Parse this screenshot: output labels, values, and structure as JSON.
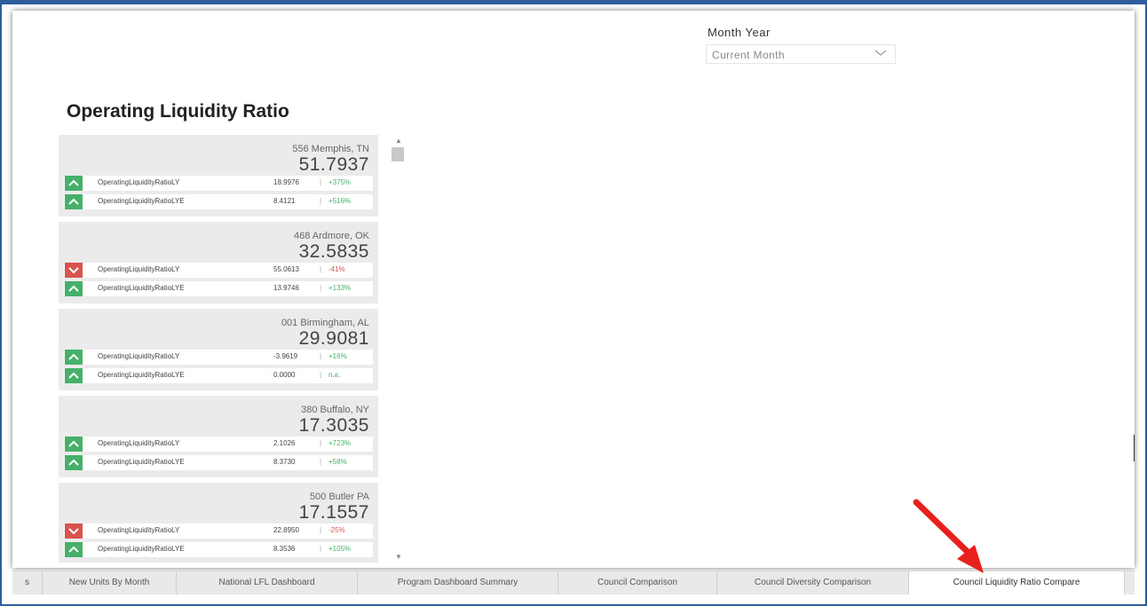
{
  "slicer": {
    "label": "Month Year",
    "value": "Current Month"
  },
  "title": "Operating Liquidity Ratio",
  "cards": [
    {
      "name": "556 Memphis, TN",
      "value": "51.7937",
      "rows": [
        {
          "label": "OperatingLiquidityRatioLY",
          "value": "18.9976",
          "sep": "|",
          "pct": "+375%",
          "trend": "up"
        },
        {
          "label": "OperatingLiquidityRatioLYE",
          "value": "8.4121",
          "sep": "|",
          "pct": "+516%",
          "trend": "up"
        }
      ]
    },
    {
      "name": "468 Ardmore, OK",
      "value": "32.5835",
      "rows": [
        {
          "label": "OperatingLiquidityRatioLY",
          "value": "55.0613",
          "sep": "|",
          "pct": "-41%",
          "trend": "down"
        },
        {
          "label": "OperatingLiquidityRatioLYE",
          "value": "13.9746",
          "sep": "|",
          "pct": "+133%",
          "trend": "up"
        }
      ]
    },
    {
      "name": "001 Birmingham, AL",
      "value": "29.9081",
      "rows": [
        {
          "label": "OperatingLiquidityRatioLY",
          "value": "-3.9619",
          "sep": "|",
          "pct": "+16%",
          "trend": "up"
        },
        {
          "label": "OperatingLiquidityRatioLYE",
          "value": "0.0000",
          "sep": "|",
          "pct": "n.a.",
          "trend": "up"
        }
      ]
    },
    {
      "name": "380 Buffalo, NY",
      "value": "17.3035",
      "rows": [
        {
          "label": "OperatingLiquidityRatioLY",
          "value": "2.1026",
          "sep": "|",
          "pct": "+723%",
          "trend": "up"
        },
        {
          "label": "OperatingLiquidityRatioLYE",
          "value": "8.3730",
          "sep": "|",
          "pct": "+58%",
          "trend": "up"
        }
      ]
    },
    {
      "name": "500 Butler PA",
      "value": "17.1557",
      "rows": [
        {
          "label": "OperatingLiquidityRatioLY",
          "value": "22.8950",
          "sep": "|",
          "pct": "-25%",
          "trend": "down"
        },
        {
          "label": "OperatingLiquidityRatioLYE",
          "value": "8.3536",
          "sep": "|",
          "pct": "+105%",
          "trend": "up"
        }
      ]
    }
  ],
  "tabs": [
    {
      "label": "s",
      "active": false
    },
    {
      "label": "New Units By Month",
      "active": false
    },
    {
      "label": "National LFL Dashboard",
      "active": false
    },
    {
      "label": "Program Dashboard Summary",
      "active": false
    },
    {
      "label": "Council Comparison",
      "active": false
    },
    {
      "label": "Council Diversity Comparison",
      "active": false
    },
    {
      "label": "Council Liquidity Ratio Compare",
      "active": true
    }
  ],
  "colors": {
    "frame": "#2e5d9e",
    "up": "#46b06a",
    "down": "#d9534f",
    "annotation_arrow": "#e8201b"
  },
  "icons": {
    "slicer": "chevron-down-icon",
    "up": "chevron-up-icon",
    "down": "chevron-down-icon",
    "annotation": "red-pointer-arrow"
  }
}
